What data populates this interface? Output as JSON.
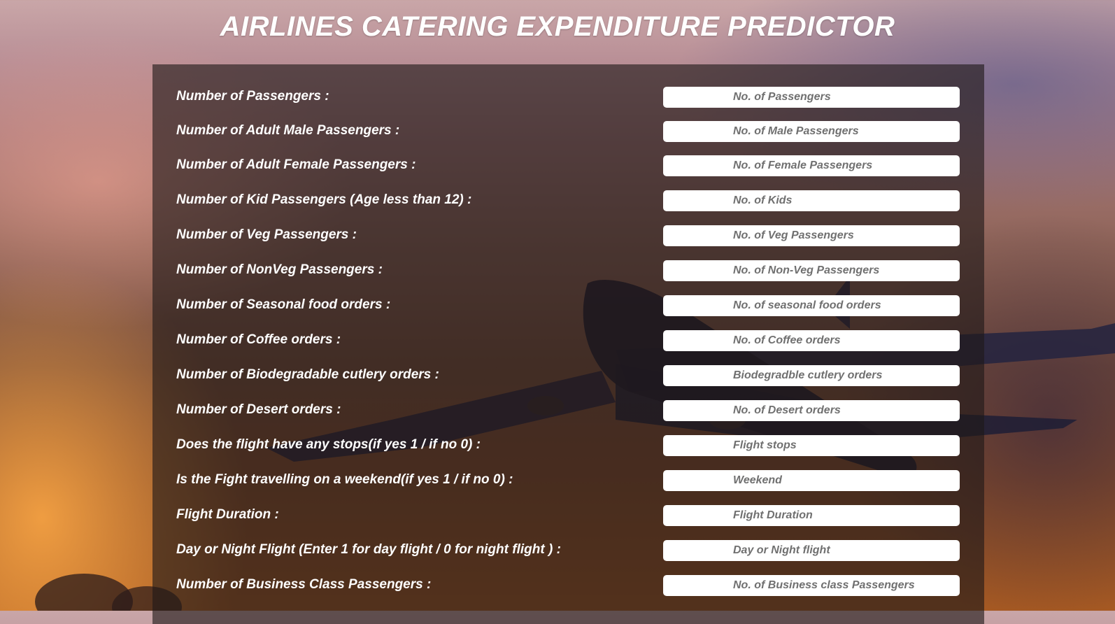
{
  "title": "AIRLINES CATERING EXPENDITURE PREDICTOR",
  "form": {
    "fields": [
      {
        "label": "Number of Passengers :",
        "placeholder": "No. of Passengers",
        "value": ""
      },
      {
        "label": "Number of Adult Male Passengers :",
        "placeholder": "No. of Male Passengers",
        "value": ""
      },
      {
        "label": "Number of Adult Female Passengers :",
        "placeholder": "No. of Female Passengers",
        "value": ""
      },
      {
        "label": "Number of Kid Passengers (Age less than 12) :",
        "placeholder": "No. of Kids",
        "value": ""
      },
      {
        "label": "Number of Veg Passengers :",
        "placeholder": "No. of Veg Passengers",
        "value": ""
      },
      {
        "label": "Number of NonVeg Passengers :",
        "placeholder": "No. of Non-Veg Passengers",
        "value": ""
      },
      {
        "label": "Number of Seasonal food orders :",
        "placeholder": "No. of seasonal food orders",
        "value": ""
      },
      {
        "label": "Number of Coffee orders :",
        "placeholder": "No. of Coffee orders",
        "value": ""
      },
      {
        "label": "Number of Biodegradable cutlery orders :",
        "placeholder": "Biodegradble cutlery orders",
        "value": ""
      },
      {
        "label": "Number of Desert orders :",
        "placeholder": "No. of Desert orders",
        "value": ""
      },
      {
        "label": "Does the flight have any stops(if yes 1 / if no 0) :",
        "placeholder": "Flight stops",
        "value": ""
      },
      {
        "label": "Is the Fight travelling on a weekend(if yes 1 / if no 0) :",
        "placeholder": "Weekend",
        "value": ""
      },
      {
        "label": "Flight Duration :",
        "placeholder": "Flight Duration",
        "value": ""
      },
      {
        "label": "Day or Night Flight (Enter 1 for day flight / 0 for night flight ) :",
        "placeholder": "Day or Night flight",
        "value": ""
      },
      {
        "label": "Number of Business Class Passengers :",
        "placeholder": "No. of Business class Passengers",
        "value": ""
      }
    ]
  }
}
